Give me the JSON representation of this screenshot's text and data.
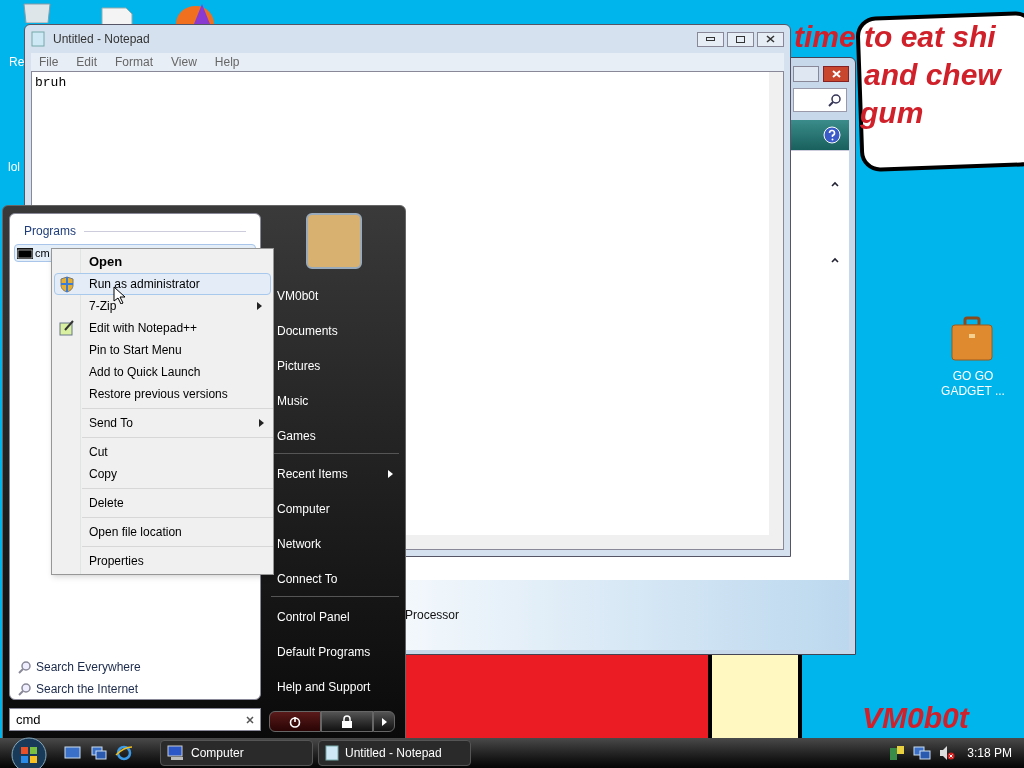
{
  "desktop": {
    "wallpaper_lines": [
      "time to eat shi",
      "and chew",
      "gum"
    ],
    "signature": "VM0b0t",
    "icons": [
      {
        "label": "Re",
        "kind": "recycle"
      },
      {
        "label": "lol",
        "kind": "file"
      },
      {
        "label": "GO GO GADGET ...",
        "kind": "briefcase"
      }
    ]
  },
  "notepad": {
    "title": "Untitled - Notepad",
    "menu": [
      "File",
      "Edit",
      "Format",
      "View",
      "Help"
    ],
    "content": "bruh"
  },
  "background_window": {
    "footer_text": "Processor"
  },
  "start_menu": {
    "programs_heading": "Programs",
    "programs": [
      {
        "label": "cm",
        "selected": true
      }
    ],
    "search_links": [
      "Search Everywhere",
      "Search the Internet"
    ],
    "search_value": "cmd",
    "user_name": "VM0b0t",
    "place_groups": [
      [
        {
          "label": "Documents",
          "submenu": false
        },
        {
          "label": "Pictures",
          "submenu": false
        },
        {
          "label": "Music",
          "submenu": false
        },
        {
          "label": "Games",
          "submenu": false
        }
      ],
      [
        {
          "label": "Recent Items",
          "submenu": true
        },
        {
          "label": "Computer",
          "submenu": false
        },
        {
          "label": "Network",
          "submenu": false
        },
        {
          "label": "Connect To",
          "submenu": false
        }
      ],
      [
        {
          "label": "Control Panel",
          "submenu": false
        },
        {
          "label": "Default Programs",
          "submenu": false
        },
        {
          "label": "Help and Support",
          "submenu": false
        }
      ]
    ]
  },
  "context_menu": {
    "groups": [
      [
        {
          "label": "Open",
          "bold": true,
          "selected": false,
          "submenu": false,
          "kind": "plain"
        },
        {
          "label": "Run as administrator",
          "bold": false,
          "selected": true,
          "submenu": false,
          "kind": "shield"
        },
        {
          "label": "7-Zip",
          "bold": false,
          "selected": false,
          "submenu": true,
          "kind": "plain"
        },
        {
          "label": "Edit with Notepad++",
          "bold": false,
          "selected": false,
          "submenu": false,
          "kind": "notepad"
        },
        {
          "label": "Pin to Start Menu",
          "bold": false,
          "selected": false,
          "submenu": false,
          "kind": "plain"
        },
        {
          "label": "Add to Quick Launch",
          "bold": false,
          "selected": false,
          "submenu": false,
          "kind": "plain"
        },
        {
          "label": "Restore previous versions",
          "bold": false,
          "selected": false,
          "submenu": false,
          "kind": "plain"
        }
      ],
      [
        {
          "label": "Send To",
          "bold": false,
          "selected": false,
          "submenu": true,
          "kind": "plain"
        }
      ],
      [
        {
          "label": "Cut",
          "bold": false,
          "selected": false,
          "submenu": false,
          "kind": "plain"
        },
        {
          "label": "Copy",
          "bold": false,
          "selected": false,
          "submenu": false,
          "kind": "plain"
        }
      ],
      [
        {
          "label": "Delete",
          "bold": false,
          "selected": false,
          "submenu": false,
          "kind": "plain"
        }
      ],
      [
        {
          "label": "Open file location",
          "bold": false,
          "selected": false,
          "submenu": false,
          "kind": "plain"
        }
      ],
      [
        {
          "label": "Properties",
          "bold": false,
          "selected": false,
          "submenu": false,
          "kind": "plain"
        }
      ]
    ]
  },
  "taskbar": {
    "tasks": [
      {
        "label": "Computer",
        "kind": "computer",
        "selected": false
      },
      {
        "label": "Untitled - Notepad",
        "kind": "notepad",
        "selected": false
      }
    ],
    "clock": "3:18 PM"
  }
}
